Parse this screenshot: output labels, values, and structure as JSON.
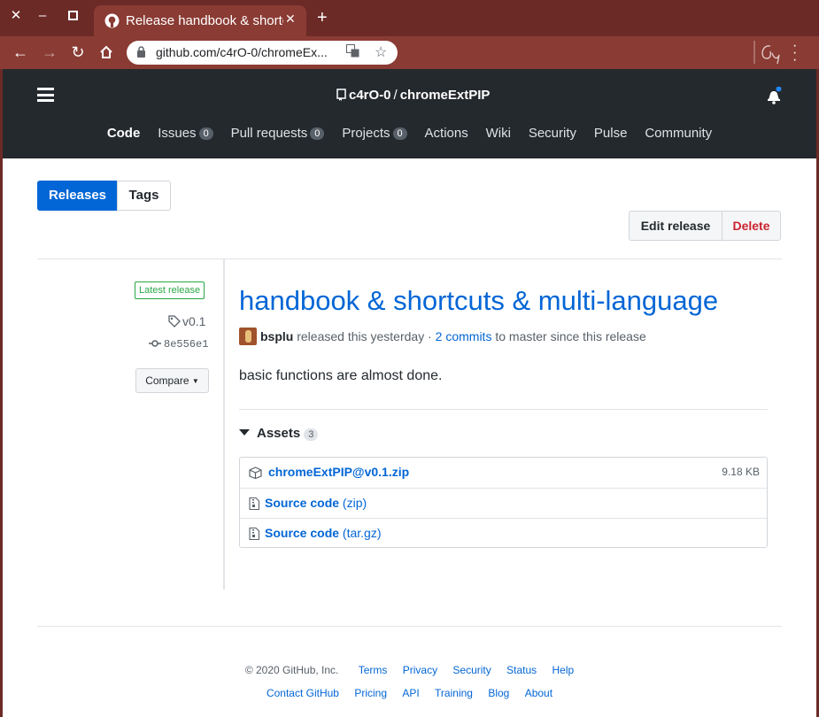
{
  "browser": {
    "tab_title": "Release handbook & shortcuts & multi-language",
    "url": "github.com/c4rO-0/chromeEx...",
    "theme_color": "#8a3b34"
  },
  "header": {
    "owner": "c4rO-0",
    "separator": "/",
    "repo": "chromeExtPIP",
    "nav": [
      {
        "label": "Code",
        "count": null
      },
      {
        "label": "Issues",
        "count": "0"
      },
      {
        "label": "Pull requests",
        "count": "0"
      },
      {
        "label": "Projects",
        "count": "0"
      },
      {
        "label": "Actions",
        "count": null
      },
      {
        "label": "Wiki",
        "count": null
      },
      {
        "label": "Security",
        "count": null
      },
      {
        "label": "Pulse",
        "count": null
      },
      {
        "label": "Community",
        "count": null
      }
    ]
  },
  "tabs": {
    "releases": "Releases",
    "tags": "Tags"
  },
  "actions": {
    "edit": "Edit release",
    "delete": "Delete"
  },
  "sidebar": {
    "badge": "Latest release",
    "tag": "v0.1",
    "commit": "8e556e1",
    "compare": "Compare"
  },
  "release": {
    "title": "handbook & shortcuts & multi-language",
    "author": "bsplu",
    "released_text": "released this yesterday",
    "dot": "·",
    "commits_link": "2 commits",
    "commits_suffix": "to master since this release",
    "body": "basic functions are almost done."
  },
  "assets": {
    "heading": "Assets",
    "count": "3",
    "items": [
      {
        "name": "chromeExtPIP@v0.1.zip",
        "suffix": "",
        "size": "9.18 KB"
      },
      {
        "name": "Source code",
        "suffix": "(zip)",
        "size": ""
      },
      {
        "name": "Source code",
        "suffix": "(tar.gz)",
        "size": ""
      }
    ]
  },
  "footer": {
    "copyright": "© 2020 GitHub, Inc.",
    "row1": [
      "Terms",
      "Privacy",
      "Security",
      "Status",
      "Help"
    ],
    "row2": [
      "Contact GitHub",
      "Pricing",
      "API",
      "Training",
      "Blog",
      "About"
    ]
  }
}
